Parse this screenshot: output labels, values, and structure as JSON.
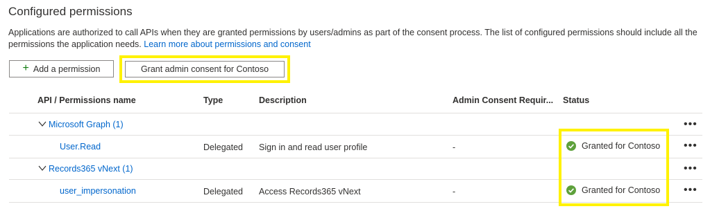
{
  "section": {
    "title": "Configured permissions",
    "description": "Applications are authorized to call APIs when they are granted permissions by users/admins as part of the consent process. The list of configured permissions should include all the permissions the application needs. ",
    "learn_more_link": "Learn more about permissions and consent"
  },
  "toolbar": {
    "add_permission_label": "Add a permission",
    "grant_consent_label": "Grant admin consent for Contoso"
  },
  "table": {
    "columns": [
      "API / Permissions name",
      "Type",
      "Description",
      "Admin Consent Requir...",
      "Status"
    ],
    "groups": [
      {
        "name": "Microsoft Graph (1)",
        "permission": {
          "name": "User.Read",
          "type": "Delegated",
          "description": "Sign in and read user profile",
          "admin_consent": "-",
          "status": "Granted for Contoso"
        }
      },
      {
        "name": "Records365 vNext (1)",
        "permission": {
          "name": "user_impersonation",
          "type": "Delegated",
          "description": "Access Records365 vNext",
          "admin_consent": "-",
          "status": "Granted for Contoso"
        }
      }
    ],
    "more_glyph": "•••"
  },
  "colors": {
    "link": "#0066cc",
    "success": "#5ea13c",
    "highlight": "#fff200",
    "border": "#e1dfdd"
  },
  "icons": [
    "plus-icon",
    "chevron-down-icon",
    "checkmark-circle-icon",
    "more-options-icon"
  ]
}
